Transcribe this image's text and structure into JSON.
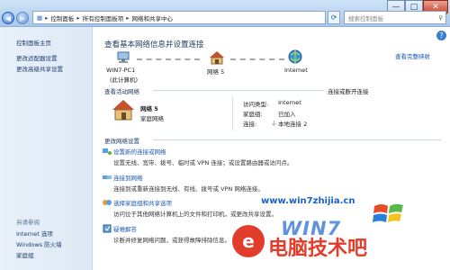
{
  "window": {
    "caption_buttons": {
      "minimize": "—",
      "maximize": "□",
      "close": "✕"
    }
  },
  "addressbar": {
    "segments": [
      "控制面板",
      "所有控制面板项",
      "网络和共享中心"
    ],
    "search_placeholder": "搜索控制面板"
  },
  "sidebar": {
    "links": [
      "控制面板主页",
      "更改适配器设置",
      "更改高级共享设置"
    ],
    "see_also_header": "另请参阅",
    "see_also": [
      "Internet 选项",
      "Windows 防火墙",
      "家庭组"
    ]
  },
  "main": {
    "title": "查看基本网络信息并设置连接",
    "full_map_link": "查看完整映射",
    "map": {
      "computer": "WIN7-PC1",
      "computer_sub": "(此计算机)",
      "network": "网络  5",
      "internet": "Internet"
    },
    "active_header": "查看活动网络",
    "connect_link": "连接或断开连接",
    "active": {
      "name": "网络  5",
      "type": "家庭网络",
      "access_label": "访问类型:",
      "access_value": "Internet",
      "homegroup_label": "家庭组:",
      "homegroup_value": "已加入",
      "conn_label": "连接:",
      "conn_value": "本地连接 2"
    },
    "change_header": "更改网络设置",
    "tasks": [
      {
        "title": "设置新的连接或网络",
        "desc": "设置无线、宽带、拨号、临时或 VPN 连接；或设置路由器或访问点。"
      },
      {
        "title": "连接到网络",
        "desc": "连接到或重新连接到无线、有线、拨号或 VPN 网络连接。"
      },
      {
        "title": "选择家庭组和共享选项",
        "desc": "访问位于其他网络计算机上的文件和打印机，或更改共享设置。"
      },
      {
        "title": "疑难解答",
        "desc": "诊断并修复网络问题，或获得故障排除信息。"
      }
    ]
  },
  "watermark": {
    "url": "www.win7zhijia.cn",
    "brand": "WIN7",
    "site": "电脑技术吧",
    "logo": "e"
  }
}
